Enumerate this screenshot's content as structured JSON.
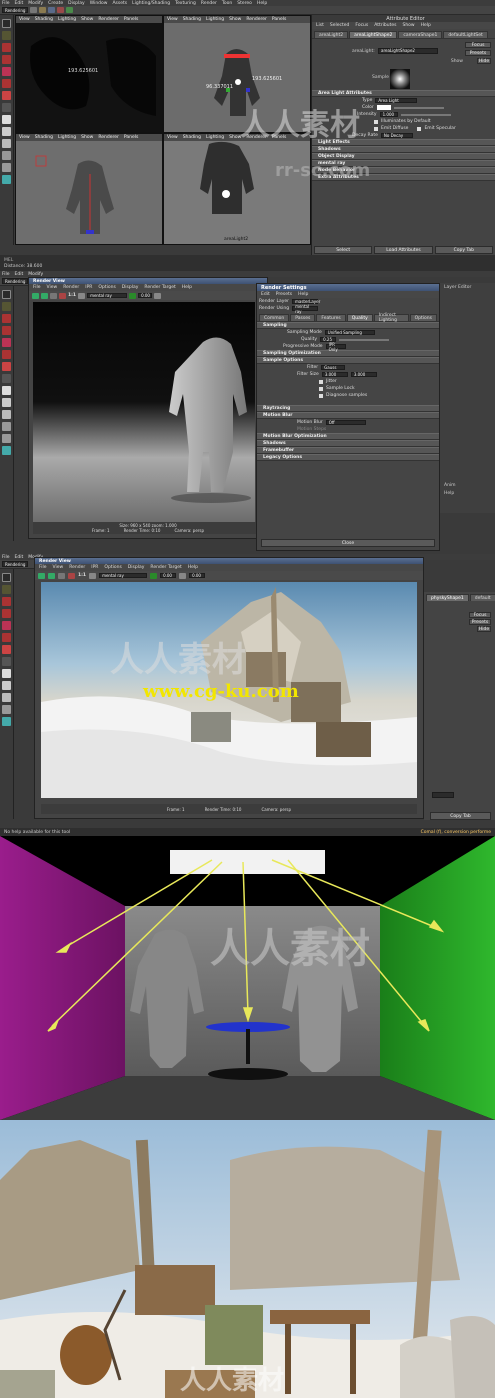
{
  "panel1": {
    "menu": [
      "File",
      "Edit",
      "Modify",
      "Create",
      "Display",
      "Window",
      "Assets",
      "Lighting/Shading",
      "Texturing",
      "Render",
      "Toon",
      "Stereo",
      "Help"
    ],
    "mode": "Rendering",
    "viewport_menu": [
      "View",
      "Shading",
      "Lighting",
      "Show",
      "Renderer",
      "Panels"
    ],
    "readout_top": "193.625601",
    "readout_persp": "193.625601",
    "readout_persp2": "96.337011",
    "cam_label": "areaLight2",
    "distance_label": "Distance",
    "distance_value": "38.600",
    "ae": {
      "title": "Attribute Editor",
      "menu": [
        "List",
        "Selected",
        "Focus",
        "Attributes",
        "Show",
        "Help"
      ],
      "tabs": [
        "areaLight2",
        "areaLightShape2",
        "cameraShape1",
        "defaultLightSet"
      ],
      "node_label": "areaLight:",
      "node_value": "areaLightShape2",
      "focus_btn": "Focus",
      "presets_btn": "Presets",
      "show_btn": "Show",
      "hide_btn": "Hide",
      "sample_label": "Sample",
      "section_main": "Area Light Attributes",
      "type_label": "Type",
      "type_value": "Area Light",
      "color_label": "Color",
      "intensity_label": "Intensity",
      "intensity_value": "1.000",
      "illum_default": "Illuminates by Default",
      "emit_diffuse": "Emit Diffuse",
      "emit_specular": "Emit Specular",
      "decay_label": "Decay Rate",
      "decay_value": "No Decay",
      "sections": [
        "Light Effects",
        "Shadows",
        "Object Display",
        "mental ray",
        "Node Behavior",
        "Extra Attributes"
      ],
      "select_btn": "Select",
      "load_btn": "Load Attributes",
      "copy_btn": "Copy Tab"
    }
  },
  "panel2": {
    "menu": [
      "File",
      "Edit",
      "Modify"
    ],
    "mode": "Rendering",
    "rv": {
      "title": "Render View",
      "menu": [
        "File",
        "View",
        "Render",
        "IPR",
        "Options",
        "Display",
        "Render Target",
        "Help"
      ],
      "renderer": "mental ray",
      "ratio": "1:1",
      "zero1": "0.00",
      "zero2": "0.00",
      "info1": "Size: 960 x 540  zoom: 1.000",
      "frame_label": "Frame: 1",
      "render_time": "Render Time: 0:10",
      "camera": "Camera: persp"
    },
    "rs": {
      "title": "Render Settings",
      "menu": [
        "Edit",
        "Presets",
        "Help"
      ],
      "layer_label": "Render Layer",
      "layer_value": "masterLayer",
      "using_label": "Render Using",
      "using_value": "mental ray",
      "tabs": [
        "Common",
        "Passes",
        "Features",
        "Quality",
        "Indirect Lighting",
        "Options"
      ],
      "sampling": "Sampling",
      "sampling_mode_label": "Sampling Mode",
      "sampling_mode_value": "Unified Sampling",
      "quality_label": "Quality",
      "quality_value": "0.25",
      "progressive_label": "Progressive Mode",
      "progressive_value": "IPR Only",
      "sampling_opt": "Sampling Optimization",
      "sample_options": "Sample Options",
      "filter_label": "Filter",
      "filter_value": "Gauss",
      "filter_size_label": "Filter Size",
      "filter_size_1": "3.000",
      "filter_size_2": "3.000",
      "jitter": "Jitter",
      "sample_lock": "Sample Lock",
      "diag": "Diagnose samples",
      "raytracing": "Raytracing",
      "motion_blur": "Motion Blur",
      "mb_label": "Motion Blur",
      "mb_value": "Off",
      "mb_steps": "Motion Steps",
      "motion_opt": "Motion Blur Optimization",
      "shadows": "Shadows",
      "framebuffer": "Framebuffer",
      "legacy": "Legacy Options",
      "close": "Close"
    },
    "side": [
      "Layer Editor",
      "Anim",
      "Help"
    ]
  },
  "panel3": {
    "mode": "Rendering",
    "menu": [
      "File",
      "Edit",
      "Modify"
    ],
    "rv": {
      "title": "Render View",
      "menu": [
        "File",
        "View",
        "Render",
        "IPR",
        "Options",
        "Display",
        "Render Target",
        "Help"
      ],
      "renderer": "mental ray",
      "ratio": "1:1",
      "zero1": "0.00",
      "zero2": "0.00",
      "frame_label": "Frame: 1",
      "render_time": "Render Time: 0:10",
      "camera": "Camera: persp"
    },
    "url": "www.cg-ku.com",
    "node_tab": "physkyShape1",
    "default_tab": "default",
    "focus_btn": "Focus",
    "presets_btn": "Presets",
    "hide_btn": "Hide",
    "copy_btn": "Copy Tab",
    "status_left": "No help available for this tool",
    "status_right": "Comal (f), conversion performe"
  },
  "colors": {
    "magenta": "#8a1a7e",
    "green": "#1f9a1e",
    "ray": "#e8e85a",
    "maya_bg": "#444444",
    "title_blue": "#4f6488"
  }
}
